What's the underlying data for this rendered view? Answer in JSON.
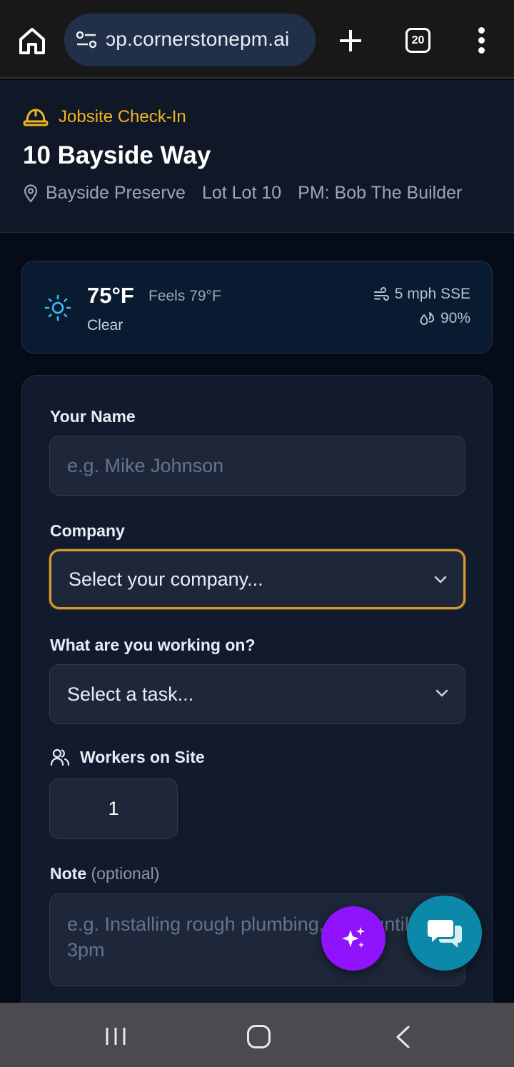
{
  "browser": {
    "url": "ɔp.cornerstonepm.ai",
    "tab_count": "20"
  },
  "header": {
    "badge": "Jobsite Check-In",
    "address": "10 Bayside Way",
    "community": "Bayside Preserve",
    "lot": "Lot Lot 10",
    "pm": "PM: Bob The Builder",
    "accent_color": "#f2b321"
  },
  "weather": {
    "temp": "75°F",
    "feels": "Feels 79°F",
    "condition": "Clear",
    "wind": "5 mph SSE",
    "humidity": "90%",
    "icon": "sun-icon"
  },
  "form": {
    "name_label": "Your Name",
    "name_placeholder": "e.g. Mike Johnson",
    "company_label": "Company",
    "company_value": "Select your company...",
    "task_label": "What are you working on?",
    "task_value": "Select a task...",
    "workers_label": "Workers on Site",
    "workers_value": "1",
    "note_label": "Note",
    "note_optional": "(optional)",
    "note_placeholder": "e.g. Installing rough plumbing, here until 3pm"
  },
  "fabs": {
    "ai_color": "#9013fe",
    "chat_color": "#0c89a8"
  }
}
